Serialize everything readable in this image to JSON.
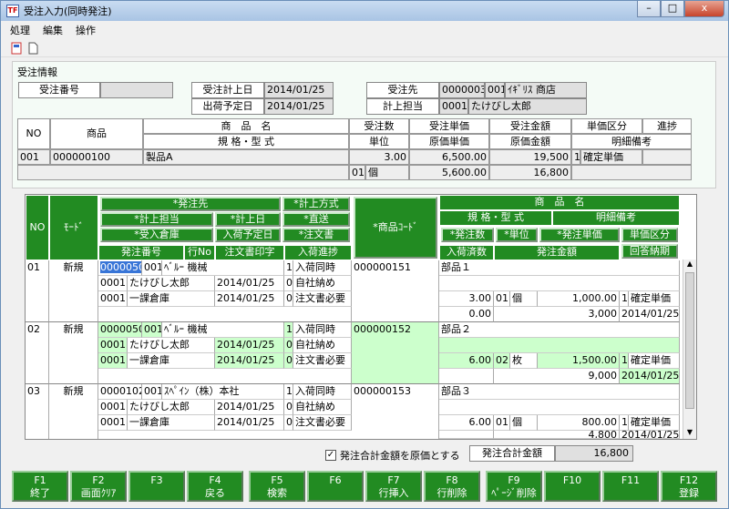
{
  "window": {
    "title": "受注入力(同時発注)",
    "app_icon": "TF",
    "controls": [
      "–",
      "□",
      "x"
    ]
  },
  "menu": [
    "処理",
    "編集",
    "操作"
  ],
  "toolbar": {
    "icons": [
      "close-doc-icon",
      "new-doc-icon"
    ]
  },
  "order_info": {
    "section_title": "受注情報",
    "labels": {
      "order_no": "受注番号",
      "recorded_date": "受注計上日",
      "ship_date": "出荷予定日",
      "customer": "受注先",
      "staff": "計上担当"
    },
    "values": {
      "order_no": "",
      "recorded_date": "2014/01/25",
      "ship_date": "2014/01/25",
      "customer_code": "0000003",
      "customer_branch": "001",
      "customer_name": "ｲｷﾞﾘｽ 商店",
      "staff_code": "0001",
      "staff_name": "たけびし太郎"
    },
    "headers": {
      "no": "NO",
      "product": "商品",
      "product_name": "商　品　名",
      "spec": "規 格・型 式",
      "qty": "受注数",
      "unit": "単位",
      "unit_price": "受注単価",
      "cost_price": "原価単価",
      "amount": "受注金額",
      "cost_amount": "原価金額",
      "price_cat": "単価区分",
      "progress": "進捗",
      "detail_note": "明細備考"
    },
    "row": {
      "no": "001",
      "code": "000000100",
      "name": "製品A",
      "qty": "3.00",
      "unit_code": "01",
      "unit": "個",
      "unit_price": "6,500.00",
      "cost_price": "5,600.00",
      "amount": "19,500",
      "cost_amount": "16,800",
      "price_cat_code": "1",
      "price_cat": "確定単価"
    }
  },
  "grid": {
    "headers": {
      "no": "NO",
      "mode": "ﾓｰﾄﾞ",
      "supplier_btn": "*発注先",
      "recorded_method_btn": "*計上方式",
      "staff_btn": "*計上担当",
      "recorded_date_btn": "*計上日",
      "direct_btn": "*直送",
      "warehouse_btn": "*受入倉庫",
      "arrival_date_btn": "入荷予定日",
      "order_doc_btn": "*注文書",
      "order_no": "発注番号",
      "line_no": "行No",
      "print": "注文書印字",
      "arrival_progress": "入荷進捗",
      "product_code_btn": "*商品ｺｰﾄﾞ",
      "product_name": "商　品　名",
      "spec": "規 格・型 式",
      "detail_note": "明細備考",
      "order_qty_btn": "*発注数",
      "unit_btn": "*単位",
      "order_price_btn": "*発注単価",
      "price_cat_btn": "単価区分",
      "arrived_qty": "入荷済数",
      "order_amount": "発注金額",
      "reply_date_btn": "回答納期"
    },
    "rows": [
      {
        "no": "01",
        "mode": "新規",
        "order_no": "0000050",
        "branch": "001",
        "supplier": "ﾍﾞﾙｰ 機械",
        "method_code": "1",
        "method": "入荷同時",
        "staff_code": "0001",
        "staff": "たけびし太郎",
        "date": "2014/01/25",
        "direct_code": "0",
        "direct": "自社納め",
        "wh_code": "0001",
        "warehouse": "一課倉庫",
        "arrival_date": "2014/01/25",
        "doc_code": "0",
        "doc": "注文書必要",
        "product_code": "000000151",
        "product_name": "部品１",
        "spec": "",
        "note": "",
        "qty": "3.00",
        "unit_code": "01",
        "unit": "個",
        "price": "1,000.00",
        "price_cat_code": "1",
        "price_cat": "確定単価",
        "arrived": "0.00",
        "amount": "3,000",
        "reply_date": "2014/01/25"
      },
      {
        "no": "02",
        "mode": "新規",
        "order_no": "0000050",
        "branch": "001",
        "supplier": "ﾍﾞﾙｰ 機械",
        "method_code": "1",
        "method": "入荷同時",
        "staff_code": "0001",
        "staff": "たけびし太郎",
        "date": "2014/01/25",
        "direct_code": "0",
        "direct": "自社納め",
        "wh_code": "0001",
        "warehouse": "一課倉庫",
        "arrival_date": "2014/01/25",
        "doc_code": "0",
        "doc": "注文書必要",
        "product_code": "000000152",
        "product_name": "部品２",
        "spec": "",
        "note": "",
        "qty": "6.00",
        "unit_code": "02",
        "unit": "枚",
        "price": "1,500.00",
        "price_cat_code": "1",
        "price_cat": "確定単価",
        "arrived": "",
        "amount": "9,000",
        "reply_date": "2014/01/25"
      },
      {
        "no": "03",
        "mode": "新規",
        "order_no": "0000102",
        "branch": "001",
        "supplier": "ｽﾍﾟｲﾝ（株）本社",
        "method_code": "1",
        "method": "入荷同時",
        "staff_code": "0001",
        "staff": "たけびし太郎",
        "date": "2014/01/25",
        "direct_code": "0",
        "direct": "自社納め",
        "wh_code": "0001",
        "warehouse": "一課倉庫",
        "arrival_date": "2014/01/25",
        "doc_code": "0",
        "doc": "注文書必要",
        "product_code": "000000153",
        "product_name": "部品３",
        "spec": "",
        "note": "",
        "qty": "6.00",
        "unit_code": "01",
        "unit": "個",
        "price": "800.00",
        "price_cat_code": "1",
        "price_cat": "確定単価",
        "arrived": "",
        "amount": "4,800",
        "reply_date": "2014/01/25"
      }
    ]
  },
  "footer": {
    "checkbox_label": "発注合計金額を原価とする",
    "checkbox_checked": "✓",
    "total_label": "発注合計金額",
    "total_value": "16,800"
  },
  "fkeys": [
    {
      "key": "F1",
      "label": "終了"
    },
    {
      "key": "F2",
      "label": "画面ｸﾘｱ"
    },
    {
      "key": "F3",
      "label": ""
    },
    {
      "key": "F4",
      "label": "戻る"
    },
    {
      "key": "F5",
      "label": "検索"
    },
    {
      "key": "F6",
      "label": ""
    },
    {
      "key": "F7",
      "label": "行挿入"
    },
    {
      "key": "F8",
      "label": "行削除"
    },
    {
      "key": "F9",
      "label": "ﾍﾟｰｼﾞ削除"
    },
    {
      "key": "F10",
      "label": ""
    },
    {
      "key": "F11",
      "label": ""
    },
    {
      "key": "F12",
      "label": "登録"
    }
  ],
  "colors": {
    "header_green": "#228b22",
    "highlight": "#ccffcc",
    "selection": "#3875d7"
  }
}
